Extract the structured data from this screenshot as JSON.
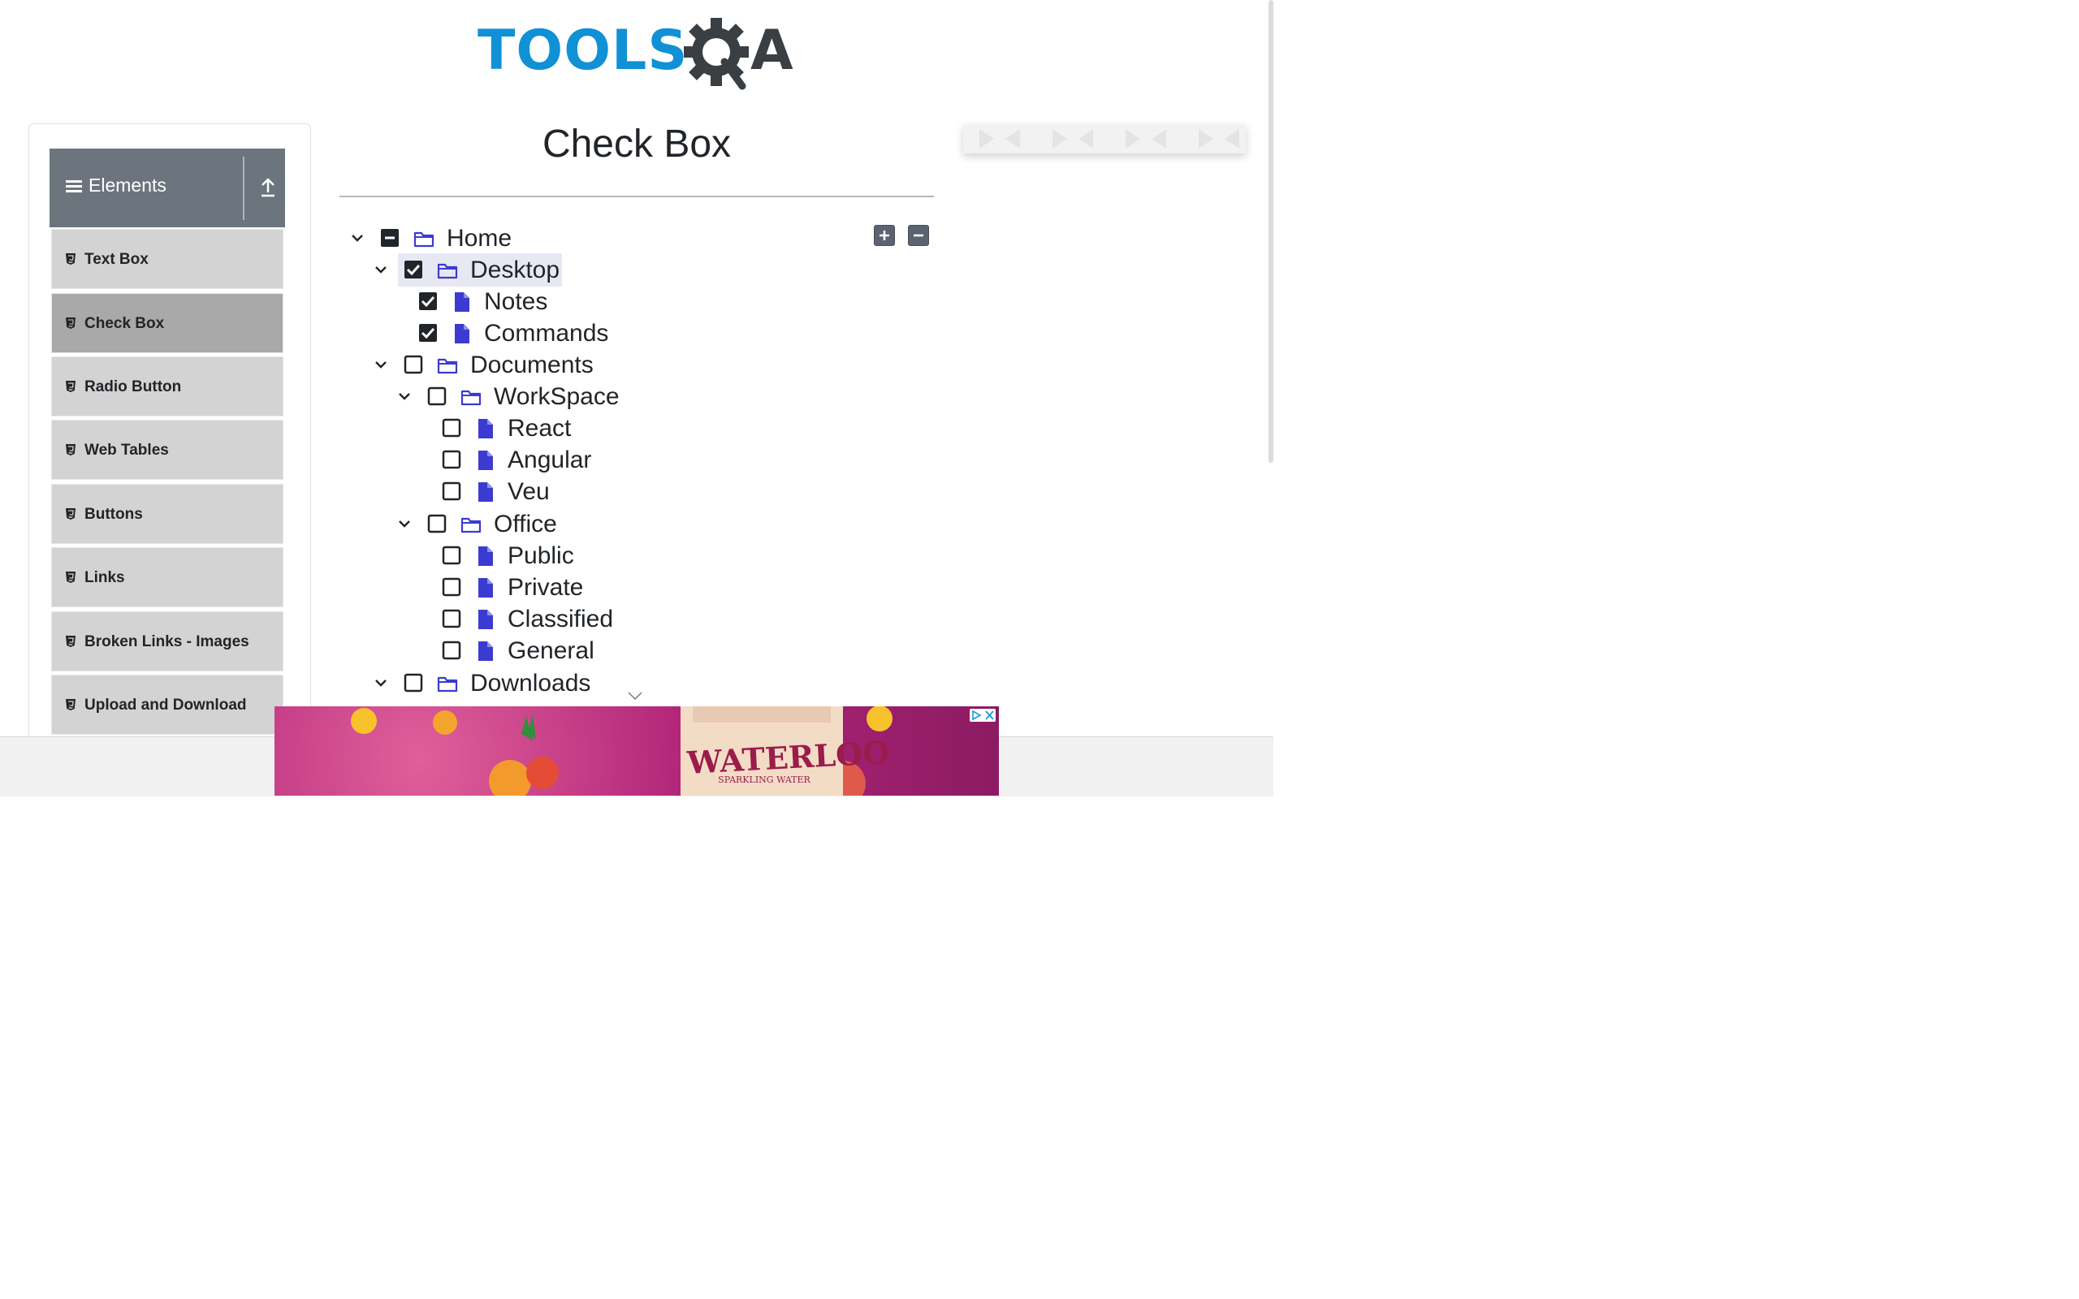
{
  "brand": {
    "logo_tools": "TOOLS",
    "logo_a": "A"
  },
  "sidebar": {
    "group_title": "Elements",
    "items": [
      {
        "label": "Text Box",
        "active": false
      },
      {
        "label": "Check Box",
        "active": true
      },
      {
        "label": "Radio Button",
        "active": false
      },
      {
        "label": "Web Tables",
        "active": false
      },
      {
        "label": "Buttons",
        "active": false
      },
      {
        "label": "Links",
        "active": false
      },
      {
        "label": "Broken Links - Images",
        "active": false
      },
      {
        "label": "Upload and Download",
        "active": false
      }
    ]
  },
  "main": {
    "title": "Check Box",
    "tree": {
      "home": "Home",
      "desktop": "Desktop",
      "notes": "Notes",
      "commands": "Commands",
      "documents": "Documents",
      "workspace": "WorkSpace",
      "react": "React",
      "angular": "Angular",
      "veu": "Veu",
      "office": "Office",
      "public": "Public",
      "private": "Private",
      "classified": "Classified",
      "general": "General",
      "downloads": "Downloads"
    },
    "states": {
      "home": "indeterminate",
      "desktop": "checked",
      "notes": "checked",
      "commands": "checked",
      "documents": "unchecked",
      "workspace": "unchecked",
      "react": "unchecked",
      "angular": "unchecked",
      "veu": "unchecked",
      "office": "unchecked",
      "public": "unchecked",
      "private": "unchecked",
      "classified": "unchecked",
      "general": "unchecked",
      "downloads": "unchecked"
    }
  },
  "ad": {
    "bottom_text": "WATERLOO",
    "bottom_subtext": "SPARKLING WATER"
  },
  "colors": {
    "folder_icon": "#3b3bd1",
    "file_icon": "#3b3bd1",
    "sidebar_header": "#6c757d",
    "logo_blue": "#1091d6"
  },
  "icons": {
    "expand_all": "plus-square-icon",
    "collapse_all": "minus-square-icon",
    "expanded": "chevron-down-icon",
    "folder": "folder-icon",
    "file": "file-icon",
    "menu": "hamburger-icon",
    "group_toggle": "upload-arrow-icon",
    "menu_item": "html5-icon"
  }
}
